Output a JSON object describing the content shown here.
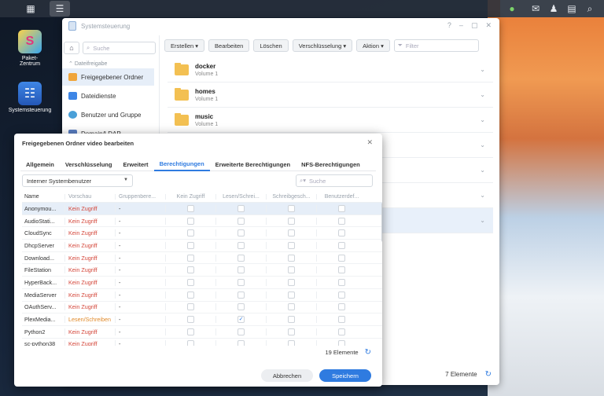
{
  "window": {
    "title": "Systemsteuerung",
    "sidebar": {
      "search_placeholder": "Suche",
      "section": "Dateifreigabe",
      "items": [
        "Freigegebener Ordner",
        "Dateidienste",
        "Benutzer und Gruppe",
        "Domain/LDAP"
      ]
    },
    "toolbar": {
      "create": "Erstellen",
      "edit": "Bearbeiten",
      "delete": "Löschen",
      "encryption": "Verschlüsselung",
      "action": "Aktion",
      "filter_placeholder": "Filter"
    },
    "folders": [
      {
        "name": "docker",
        "volume": "Volume 1"
      },
      {
        "name": "homes",
        "volume": "Volume 1"
      },
      {
        "name": "music",
        "volume": "Volume 1"
      }
    ],
    "footer_count": "7 Elemente"
  },
  "desktop": {
    "icons": [
      "Paket-\nZentrum",
      "Systemsteuerung"
    ]
  },
  "modal": {
    "title": "Freigegebenen Ordner video bearbeiten",
    "tabs": [
      "Allgemein",
      "Verschlüsselung",
      "Erweitert",
      "Berechtigungen",
      "Erweiterte Berechtigungen",
      "NFS-Berechtigungen"
    ],
    "active_tab": "Berechtigungen",
    "dropdown": "Interner Systembenutzer",
    "search_placeholder": "Suche",
    "columns": [
      "Name",
      "Vorschau",
      "Gruppenbere...",
      "Kein Zugriff",
      "Lesen/Schrei...",
      "Schreibgesch...",
      "Benutzerdef..."
    ],
    "rows": [
      {
        "name": "Anonymou...",
        "preview": "Kein Zugriff",
        "group": "-",
        "rw": false
      },
      {
        "name": "AudioStati...",
        "preview": "Kein Zugriff",
        "group": "-",
        "rw": false
      },
      {
        "name": "CloudSync",
        "preview": "Kein Zugriff",
        "group": "-",
        "rw": false
      },
      {
        "name": "DhcpServer",
        "preview": "Kein Zugriff",
        "group": "-",
        "rw": false
      },
      {
        "name": "Download...",
        "preview": "Kein Zugriff",
        "group": "-",
        "rw": false
      },
      {
        "name": "FileStation",
        "preview": "Kein Zugriff",
        "group": "-",
        "rw": false
      },
      {
        "name": "HyperBack...",
        "preview": "Kein Zugriff",
        "group": "-",
        "rw": false
      },
      {
        "name": "MediaServer",
        "preview": "Kein Zugriff",
        "group": "-",
        "rw": false
      },
      {
        "name": "OAuthServ...",
        "preview": "Kein Zugriff",
        "group": "-",
        "rw": false
      },
      {
        "name": "PlexMedia...",
        "preview": "Lesen/Schreiben",
        "group": "-",
        "rw": true
      },
      {
        "name": "Python2",
        "preview": "Kein Zugriff",
        "group": "-",
        "rw": false
      },
      {
        "name": "sc-python38",
        "preview": "Kein Zugriff",
        "group": "-",
        "rw": false
      }
    ],
    "count": "19 Elemente",
    "cancel": "Abbrechen",
    "save": "Speichern"
  }
}
